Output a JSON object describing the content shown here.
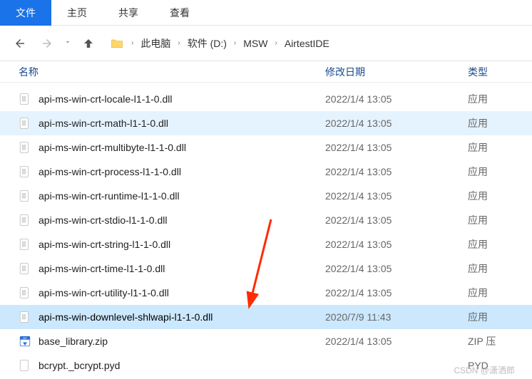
{
  "tabs": {
    "file": "文件",
    "home": "主页",
    "share": "共享",
    "view": "查看"
  },
  "breadcrumb": {
    "item0": "此电脑",
    "item1": "软件 (D:)",
    "item2": "MSW",
    "item3": "AirtestIDE"
  },
  "columns": {
    "name": "名称",
    "date": "修改日期",
    "type": "类型"
  },
  "files": [
    {
      "name": "api-ms-win-crt-locale-l1-1-0.dll",
      "date": "2022/1/4 13:05",
      "type": "应用",
      "icon": "dll"
    },
    {
      "name": "api-ms-win-crt-math-l1-1-0.dll",
      "date": "2022/1/4 13:05",
      "type": "应用",
      "icon": "dll"
    },
    {
      "name": "api-ms-win-crt-multibyte-l1-1-0.dll",
      "date": "2022/1/4 13:05",
      "type": "应用",
      "icon": "dll"
    },
    {
      "name": "api-ms-win-crt-process-l1-1-0.dll",
      "date": "2022/1/4 13:05",
      "type": "应用",
      "icon": "dll"
    },
    {
      "name": "api-ms-win-crt-runtime-l1-1-0.dll",
      "date": "2022/1/4 13:05",
      "type": "应用",
      "icon": "dll"
    },
    {
      "name": "api-ms-win-crt-stdio-l1-1-0.dll",
      "date": "2022/1/4 13:05",
      "type": "应用",
      "icon": "dll"
    },
    {
      "name": "api-ms-win-crt-string-l1-1-0.dll",
      "date": "2022/1/4 13:05",
      "type": "应用",
      "icon": "dll"
    },
    {
      "name": "api-ms-win-crt-time-l1-1-0.dll",
      "date": "2022/1/4 13:05",
      "type": "应用",
      "icon": "dll"
    },
    {
      "name": "api-ms-win-crt-utility-l1-1-0.dll",
      "date": "2022/1/4 13:05",
      "type": "应用",
      "icon": "dll"
    },
    {
      "name": "api-ms-win-downlevel-shlwapi-l1-1-0.dll",
      "date": "2020/7/9 11:43",
      "type": "应用",
      "icon": "dll"
    },
    {
      "name": "base_library.zip",
      "date": "2022/1/4 13:05",
      "type": "ZIP 压",
      "icon": "zip"
    },
    {
      "name": "bcrypt._bcrypt.pyd",
      "date": "",
      "type": "PYD",
      "icon": "pyd"
    }
  ],
  "watermark": "CSDN @潇洒郎"
}
